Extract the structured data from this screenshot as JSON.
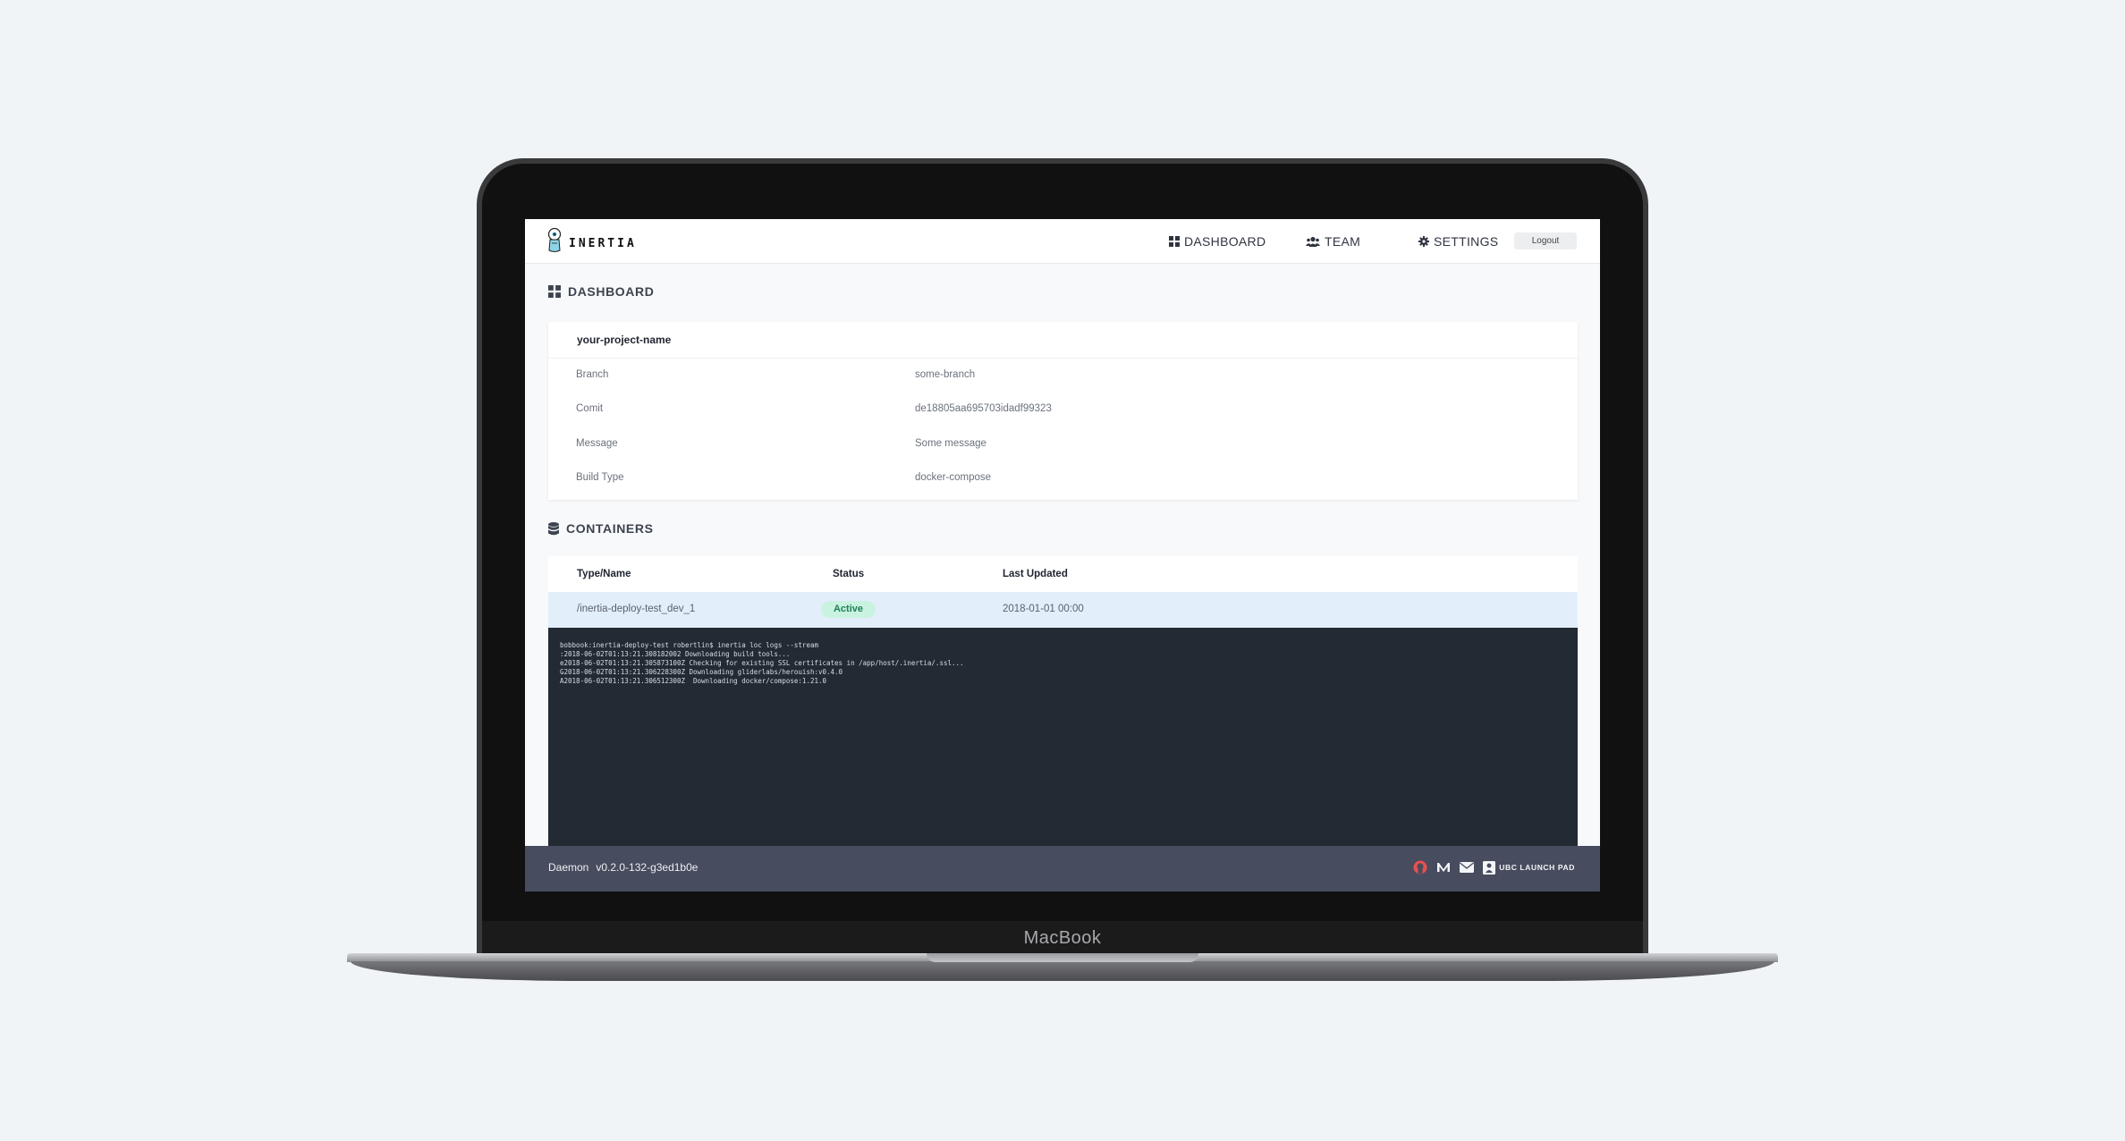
{
  "device": {
    "brand": "MacBook"
  },
  "app": {
    "logo_text": "INERTIA"
  },
  "nav": {
    "dashboard": "DASHBOARD",
    "team": "TEAM",
    "settings": "SETTINGS",
    "logout": "Logout"
  },
  "dashboard": {
    "title": "DASHBOARD",
    "project_name": "your-project-name",
    "fields": [
      {
        "label": "Branch",
        "value": "some-branch"
      },
      {
        "label": "Comit",
        "value": "de18805aa695703idadf99323"
      },
      {
        "label": "Message",
        "value": "Some message"
      },
      {
        "label": "Build Type",
        "value": "docker-compose"
      }
    ]
  },
  "containers": {
    "title": "CONTAINERS",
    "headers": {
      "name": "Type/Name",
      "status": "Status",
      "updated": "Last Updated"
    },
    "rows": [
      {
        "name": "/inertia-deploy-test_dev_1",
        "status": "Active",
        "updated": "2018-01-01 00:00"
      }
    ]
  },
  "logs": [
    "bobbook:inertia-deploy-test robertlin$ inertia loc logs --stream",
    ":2018-06-02T01:13:21.308182002 Downloading build tools...",
    "e2018-06-02T01:13:21.305873100Z Checking for existing SSL certificates in /app/host/.inertia/.ssl...",
    "G2018-06-02T01:13:21.306228300Z Downloading gliderlabs/herouish:v0.4.0",
    "A2018-06-02T01:13:21.306512300Z  Downloading docker/compose:1.21.0"
  ],
  "footer": {
    "daemon_label": "Daemon",
    "version": "v0.2.0-132-g3ed1b0e",
    "launchpad": "UBC LAUNCH PAD"
  },
  "colors": {
    "page_bg": "#f1f4f6",
    "terminal_bg": "#222a33",
    "footer_bg": "#474c5e",
    "active_row_bg": "#e3eefb",
    "badge_bg": "#c9f2e1",
    "badge_text": "#1d7f55",
    "github_icon": "#e8504f"
  }
}
